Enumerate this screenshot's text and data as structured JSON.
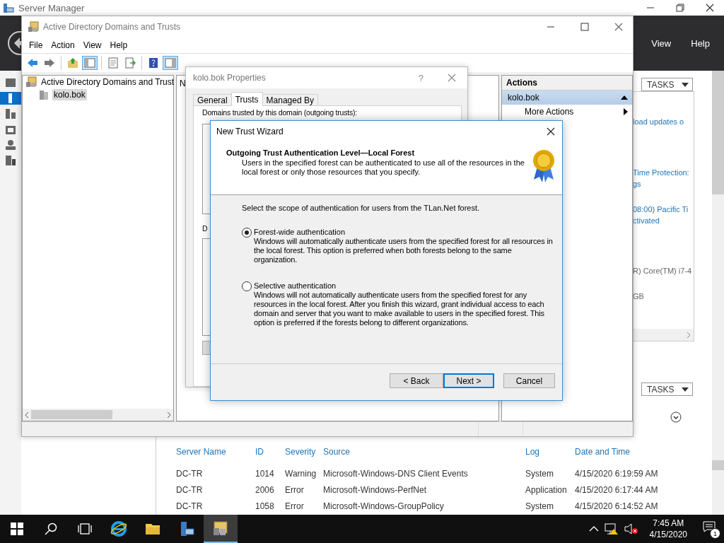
{
  "server_manager": {
    "title": "Server Manager",
    "menu": [
      "View",
      "Help"
    ],
    "nav": [
      {
        "selected": false
      },
      {
        "selected": true
      },
      {
        "selected": false
      },
      {
        "selected": false
      },
      {
        "selected": false
      },
      {
        "selected": false
      }
    ],
    "tasks_buttons": [
      "TASKS",
      "TASKS"
    ],
    "tile_lines": [
      {
        "kind": "link",
        "text": "load updates o"
      },
      {
        "kind": "link",
        "text": "Time Protection:"
      },
      {
        "kind": "link",
        "text": "gs"
      },
      {
        "kind": "link",
        "text": "08:00) Pacific Ti"
      },
      {
        "kind": "link",
        "text": "ctivated"
      },
      {
        "kind": "text",
        "text": "R) Core(TM) i7-4"
      },
      {
        "kind": "text",
        "text": "GB"
      }
    ],
    "events": {
      "columns": [
        "Server Name",
        "ID",
        "Severity",
        "Source",
        "Log",
        "Date and Time"
      ],
      "rows": [
        [
          "DC-TR",
          "1014",
          "Warning",
          "Microsoft-Windows-DNS Client Events",
          "System",
          "4/15/2020 6:19:59 AM"
        ],
        [
          "DC-TR",
          "2006",
          "Error",
          "Microsoft-Windows-PerfNet",
          "Application",
          "4/15/2020 6:17:44 AM"
        ],
        [
          "DC-TR",
          "1058",
          "Error",
          "Microsoft-Windows-GroupPolicy",
          "System",
          "4/15/2020 6:14:52 AM"
        ]
      ]
    }
  },
  "mmc": {
    "title": "Active Directory Domains and Trusts",
    "menu": [
      "File",
      "Action",
      "View",
      "Help"
    ],
    "toolbar": [
      {
        "kind": "back",
        "pressed": false
      },
      {
        "kind": "forward",
        "pressed": false
      },
      {
        "kind": "up",
        "pressed": false
      },
      {
        "kind": "tree",
        "pressed": true
      },
      {
        "kind": "properties",
        "pressed": false
      },
      {
        "kind": "export",
        "pressed": false
      },
      {
        "kind": "help",
        "pressed": false
      },
      {
        "kind": "actionpane",
        "pressed": true
      }
    ],
    "tree": {
      "label": "Active Directory Domains and Trust",
      "children": [
        {
          "label": "kolo.bok",
          "selected": true
        }
      ]
    },
    "middle_header": "N",
    "actions": {
      "title": "Actions",
      "group": {
        "label": "kolo.bok",
        "expanded": true
      },
      "items": [
        "More Actions"
      ]
    }
  },
  "properties": {
    "title": "kolo.bok Properties",
    "help": "?",
    "tabs": [
      {
        "label": "General",
        "selected": false
      },
      {
        "label": "Trusts",
        "selected": true
      },
      {
        "label": "Managed By",
        "selected": false
      }
    ],
    "outgoing_label": "Domains trusted by this domain (outgoing trusts):",
    "incoming_label": "D"
  },
  "wizard": {
    "title": "New Trust Wizard",
    "heading": "Outgoing Trust Authentication Level—Local Forest",
    "subheading": "Users in the specified forest can be authenticated to use all of the resources in the local forest or only those resources that you specify.",
    "prompt": "Select the scope of authentication for users from the TLan.Net forest.",
    "options": [
      {
        "label": "Forest-wide authentication",
        "description": "Windows will automatically authenticate users from the specified forest for all resources in the local forest. This option is preferred when both forests belong to the same organization.",
        "selected": true
      },
      {
        "label": "Selective authentication",
        "description": "Windows will not automatically authenticate users from the specified forest for any resources in the local forest. After you finish this wizard, grant individual access to each domain and server that you want to make available to users in the specified forest. This option is preferred if the forests belong to different organizations.",
        "selected": false
      }
    ],
    "buttons": [
      {
        "label": "< Back",
        "default": false
      },
      {
        "label": "Next >",
        "default": true
      },
      {
        "label": "Cancel",
        "default": false
      }
    ]
  },
  "taskbar": {
    "apps": [
      {
        "kind": "ie",
        "active": false
      },
      {
        "kind": "folder",
        "active": false
      },
      {
        "kind": "servermanager",
        "active": false
      },
      {
        "kind": "addt",
        "active": true
      }
    ],
    "time": "7:45 AM",
    "date": "4/15/2020",
    "notifications": "1"
  }
}
